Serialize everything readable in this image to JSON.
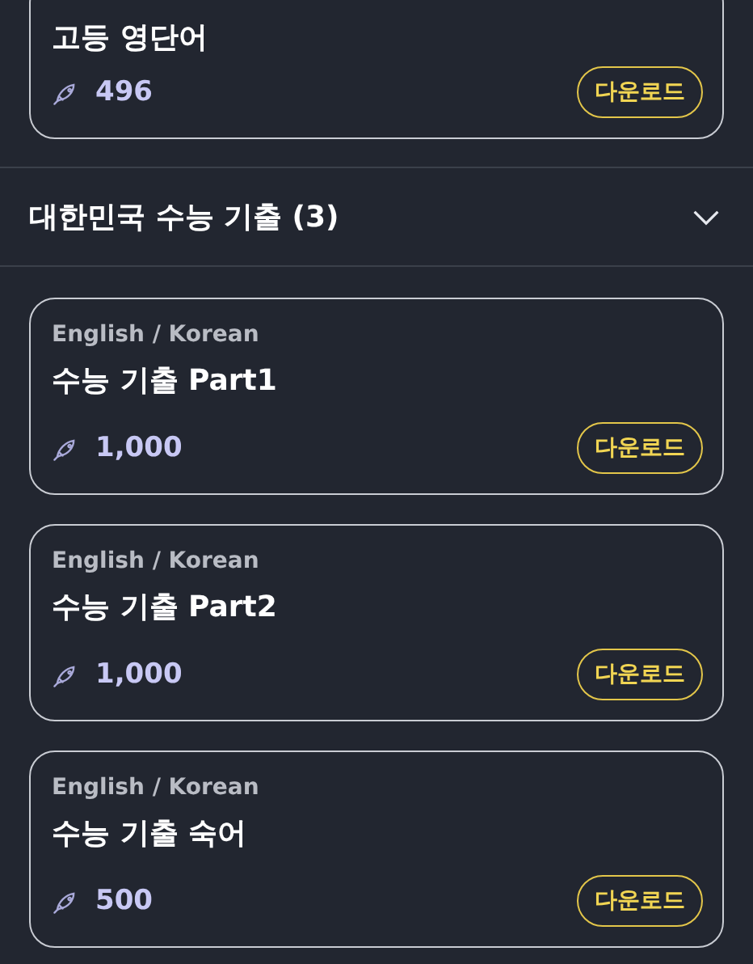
{
  "previous_card": {
    "title": "고등 영단어",
    "price": "496",
    "button": "다운로드"
  },
  "section": {
    "title": "대한민국 수능 기출 (3)",
    "expanded": true,
    "cards": [
      {
        "language": "English / Korean",
        "title": "수능 기출 Part1",
        "price": "1,000",
        "button": "다운로드"
      },
      {
        "language": "English / Korean",
        "title": "수능 기출 Part2",
        "price": "1,000",
        "button": "다운로드"
      },
      {
        "language": "English / Korean",
        "title": "수능 기출 숙어",
        "price": "500",
        "button": "다운로드"
      }
    ]
  }
}
